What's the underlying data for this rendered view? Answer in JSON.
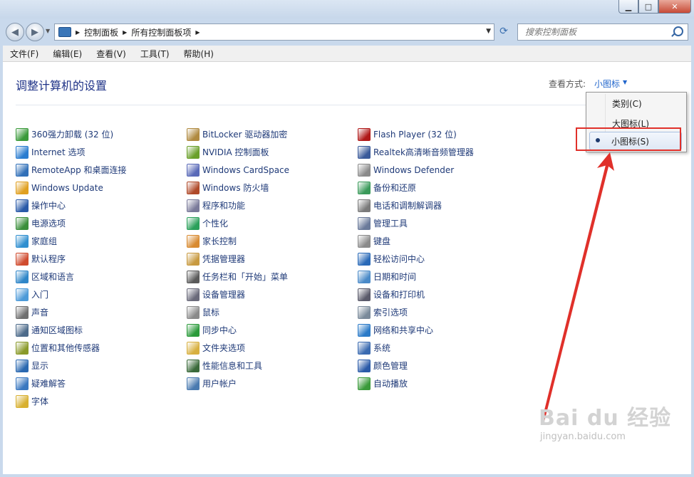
{
  "window": {
    "controls": {
      "minimize": "▁",
      "maximize": "□",
      "close": "✕"
    }
  },
  "address_bar": {
    "breadcrumbs": [
      "控制面板",
      "所有控制面板项"
    ],
    "search_placeholder": "搜索控制面板"
  },
  "menubar": [
    "文件(F)",
    "编辑(E)",
    "查看(V)",
    "工具(T)",
    "帮助(H)"
  ],
  "page": {
    "title": "调整计算机的设置",
    "view_by_label": "查看方式:",
    "view_by_value": "小图标"
  },
  "view_menu": {
    "items": [
      "类别(C)",
      "大图标(L)",
      "小图标(S)"
    ],
    "selected": "小图标(S)"
  },
  "columns": [
    [
      {
        "label": "360强力卸载 (32 位)",
        "color": "#3a9a3a"
      },
      {
        "label": "Internet 选项",
        "color": "#2b7dd0"
      },
      {
        "label": "RemoteApp 和桌面连接",
        "color": "#3170b8"
      },
      {
        "label": "Windows Update",
        "color": "#e0a020"
      },
      {
        "label": "操作中心",
        "color": "#2a5aa8"
      },
      {
        "label": "电源选项",
        "color": "#3b8f3b"
      },
      {
        "label": "家庭组",
        "color": "#2f8fd0"
      },
      {
        "label": "默认程序",
        "color": "#d04b2e"
      },
      {
        "label": "区域和语言",
        "color": "#2f86c8"
      },
      {
        "label": "入门",
        "color": "#4c9ad8"
      },
      {
        "label": "声音",
        "color": "#707070"
      },
      {
        "label": "通知区域图标",
        "color": "#4d6b8a"
      },
      {
        "label": "位置和其他传感器",
        "color": "#8a9a2a"
      },
      {
        "label": "显示",
        "color": "#2a68b0"
      },
      {
        "label": "疑难解答",
        "color": "#3a78c0"
      },
      {
        "label": "字体",
        "color": "#d8b030"
      }
    ],
    [
      {
        "label": "BitLocker 驱动器加密",
        "color": "#b08a40"
      },
      {
        "label": "NVIDIA 控制面板",
        "color": "#6aa02a"
      },
      {
        "label": "Windows CardSpace",
        "color": "#5a6ab8"
      },
      {
        "label": "Windows 防火墙",
        "color": "#b04a2a"
      },
      {
        "label": "程序和功能",
        "color": "#7a7a9a"
      },
      {
        "label": "个性化",
        "color": "#2aa05a"
      },
      {
        "label": "家长控制",
        "color": "#d88a30"
      },
      {
        "label": "凭据管理器",
        "color": "#c89a40"
      },
      {
        "label": "任务栏和「开始」菜单",
        "color": "#5a5a5a"
      },
      {
        "label": "设备管理器",
        "color": "#6a6a7a"
      },
      {
        "label": "鼠标",
        "color": "#8a8a8a"
      },
      {
        "label": "同步中心",
        "color": "#2a9a3a"
      },
      {
        "label": "文件夹选项",
        "color": "#d8b040"
      },
      {
        "label": "性能信息和工具",
        "color": "#3a6a3a"
      },
      {
        "label": "用户帐户",
        "color": "#4a7ab0"
      }
    ],
    [
      {
        "label": "Flash Player (32 位)",
        "color": "#b01818"
      },
      {
        "label": "Realtek高清晰音频管理器",
        "color": "#3a5a9a"
      },
      {
        "label": "Windows Defender",
        "color": "#8a8a8a"
      },
      {
        "label": "备份和还原",
        "color": "#3a9a5a"
      },
      {
        "label": "电话和调制解调器",
        "color": "#7a7a7a"
      },
      {
        "label": "管理工具",
        "color": "#6a7a9a"
      },
      {
        "label": "键盘",
        "color": "#8a8a8a"
      },
      {
        "label": "轻松访问中心",
        "color": "#2a6ab8"
      },
      {
        "label": "日期和时间",
        "color": "#4a8ac8"
      },
      {
        "label": "设备和打印机",
        "color": "#5a5a6a"
      },
      {
        "label": "索引选项",
        "color": "#7a8a9a"
      },
      {
        "label": "网络和共享中心",
        "color": "#2a7ac8"
      },
      {
        "label": "系统",
        "color": "#3a6ab0"
      },
      {
        "label": "颜色管理",
        "color": "#2a5aa8"
      },
      {
        "label": "自动播放",
        "color": "#3a9a3a"
      }
    ]
  ],
  "watermark": {
    "logo": "Bai du 经验",
    "url": "jingyan.baidu.com"
  },
  "colors": {
    "link": "#1f3a78",
    "title": "#1e3287",
    "annotation": "#e0302a"
  }
}
